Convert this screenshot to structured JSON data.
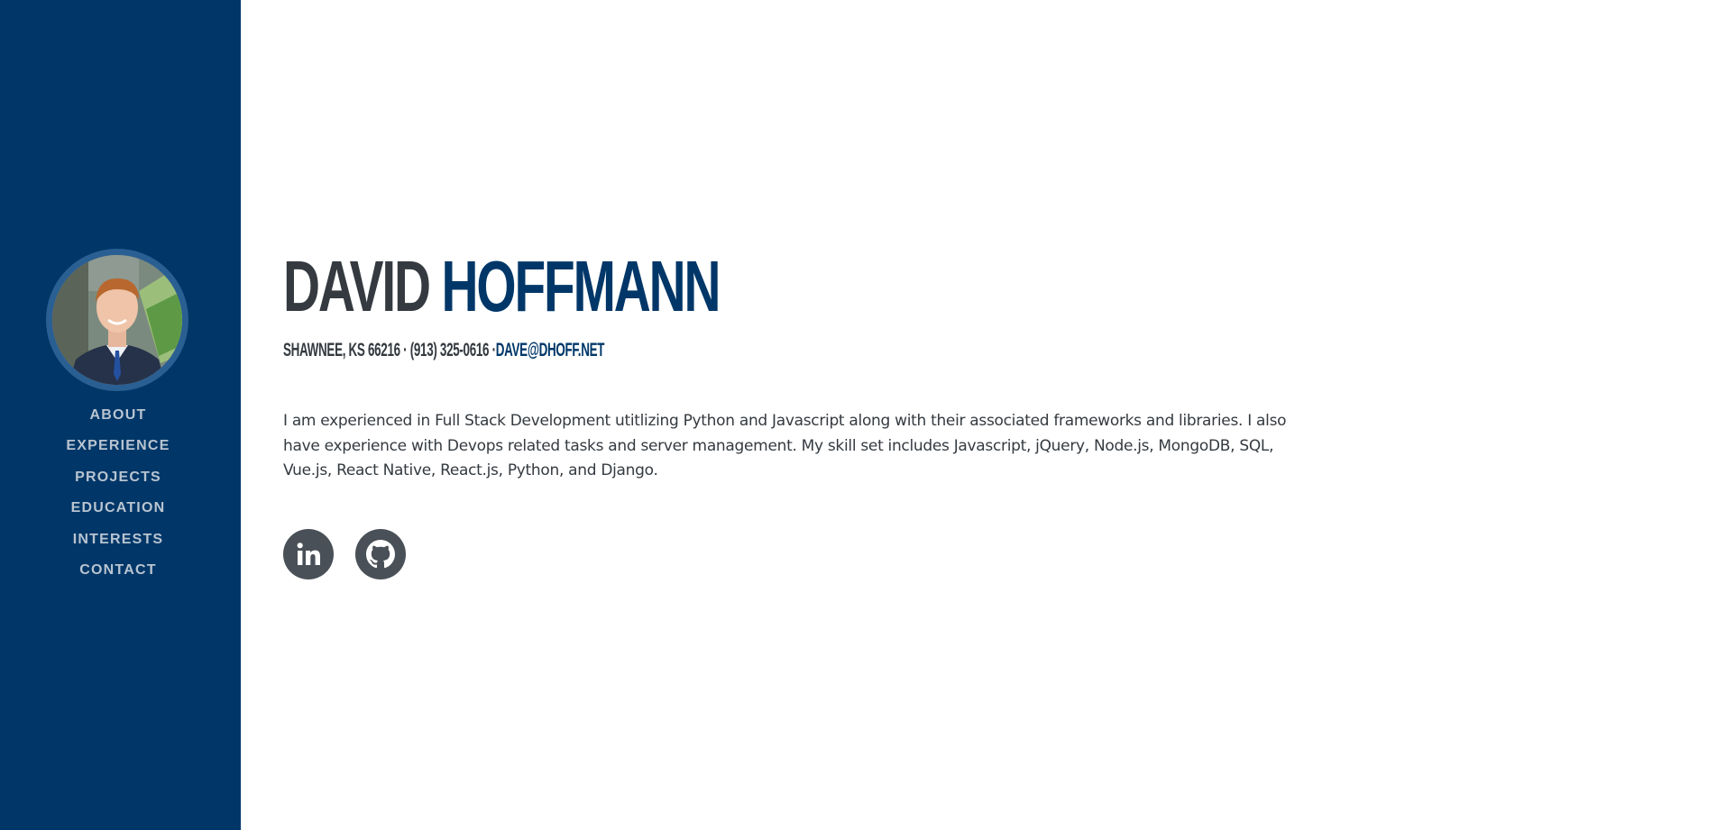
{
  "sidebar": {
    "nav": [
      {
        "label": "ABOUT"
      },
      {
        "label": "EXPERIENCE"
      },
      {
        "label": "PROJECTS"
      },
      {
        "label": "EDUCATION"
      },
      {
        "label": "INTERESTS"
      },
      {
        "label": "CONTACT"
      }
    ]
  },
  "about": {
    "first_name": "DAVID",
    "last_name": "HOFFMANN",
    "location_phone": "SHAWNEE, KS 66216 · (913) 325-0616 ·",
    "email": "DAVE@DHOFF.NET",
    "description": "I am experienced in Full Stack Development utitlizing Python and Javascript along with their associated frameworks and libraries. I also have experience with Devops related tasks and server management. My skill set includes Javascript, jQuery, Node.js, MongoDB, SQL, Vue.js, React Native, React.js, Python, and Django."
  },
  "social": [
    {
      "icon": "linkedin-icon"
    },
    {
      "icon": "github-icon"
    }
  ],
  "colors": {
    "primary": "#003768",
    "text": "#343a40",
    "nav_text": "#b9c4d1",
    "social_bg": "#495057"
  }
}
